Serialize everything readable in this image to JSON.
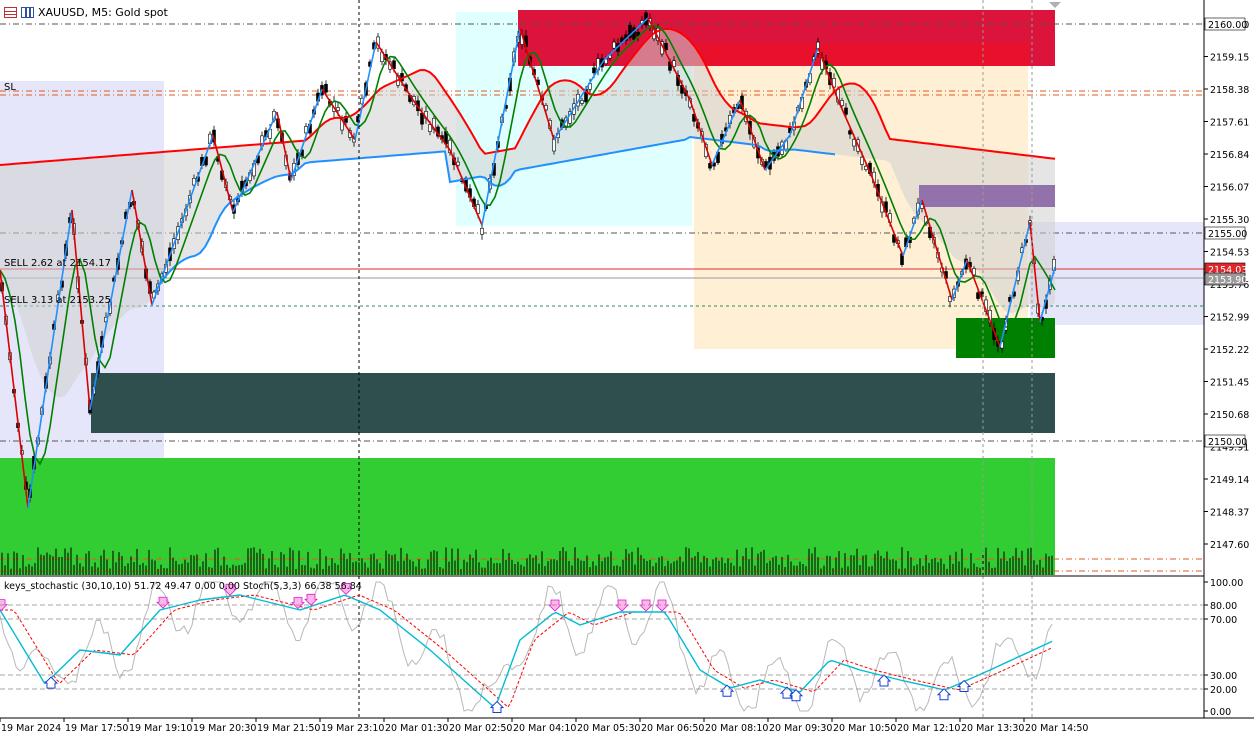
{
  "window": {
    "title": "XAUUSD, M5:  Gold spot",
    "icon_left": "chart-grid-icon",
    "icon_right": "candles-icon"
  },
  "price_axis": {
    "ticks": [
      "2160.00",
      "2159.15",
      "2158.38",
      "2157.61",
      "2156.84",
      "2156.07",
      "2155.30",
      "2154.53",
      "2153.76",
      "2152.99",
      "2152.22",
      "2151.45",
      "2150.68",
      "2149.91",
      "2149.14",
      "2148.37",
      "2147.60"
    ],
    "tags": [
      {
        "label": "2160.00",
        "bg": "#ffffff",
        "fg": "#000000"
      },
      {
        "label": "2155.00",
        "bg": "#ffffff",
        "fg": "#000000"
      },
      {
        "label": "2154.03",
        "bg": "#e0282c",
        "fg": "#ffffff"
      },
      {
        "label": "2153.90",
        "bg": "#9a9a9a",
        "fg": "#ffffff"
      },
      {
        "label": "2150.00",
        "bg": "#ffffff",
        "fg": "#000000"
      }
    ]
  },
  "chart_labels": {
    "sl": "SL",
    "sell1": "SELL 2.62 at 2154.17",
    "sell2": "SELL 3.13 at 2153.25"
  },
  "indicator": {
    "label": "keys_stochastic (30,10,10) 51.72 49.47 0.00 0.00 Stoch(5,3,3) 66.38 56.84",
    "ticks": [
      "100.00",
      "80.00",
      "70.00",
      "30.00",
      "20.00",
      "0.00"
    ]
  },
  "time_axis": {
    "labels": [
      "19 Mar 2024",
      "19 Mar 17:50",
      "19 Mar 19:10",
      "19 Mar 20:30",
      "19 Mar 21:50",
      "19 Mar 23:10",
      "20 Mar 01:30",
      "20 Mar 02:50",
      "20 Mar 04:10",
      "20 Mar 05:30",
      "20 Mar 06:50",
      "20 Mar 08:10",
      "20 Mar 09:30",
      "20 Mar 10:50",
      "20 Mar 12:10",
      "20 Mar 13:30",
      "20 Mar 14:50"
    ]
  },
  "colors": {
    "bull_zone": "#32cd32",
    "dark_zone": "#2f4f4f",
    "supply_zone": "#dc143c",
    "violet_zone": "#4b0082",
    "demand_small": "#008000",
    "lavender": "#e6e6fa",
    "cyan_zone": "#e0ffff",
    "wheat_zone": "#ffefd5",
    "ma_red": "#ff0000",
    "ma_blue": "#1e90ff",
    "ma_green": "#008000",
    "zigzag_up": "#1e90ff",
    "zigzag_down": "#dc0000",
    "stoch_main": "#00bcd4",
    "stoch_signal": "#ff0000"
  }
}
